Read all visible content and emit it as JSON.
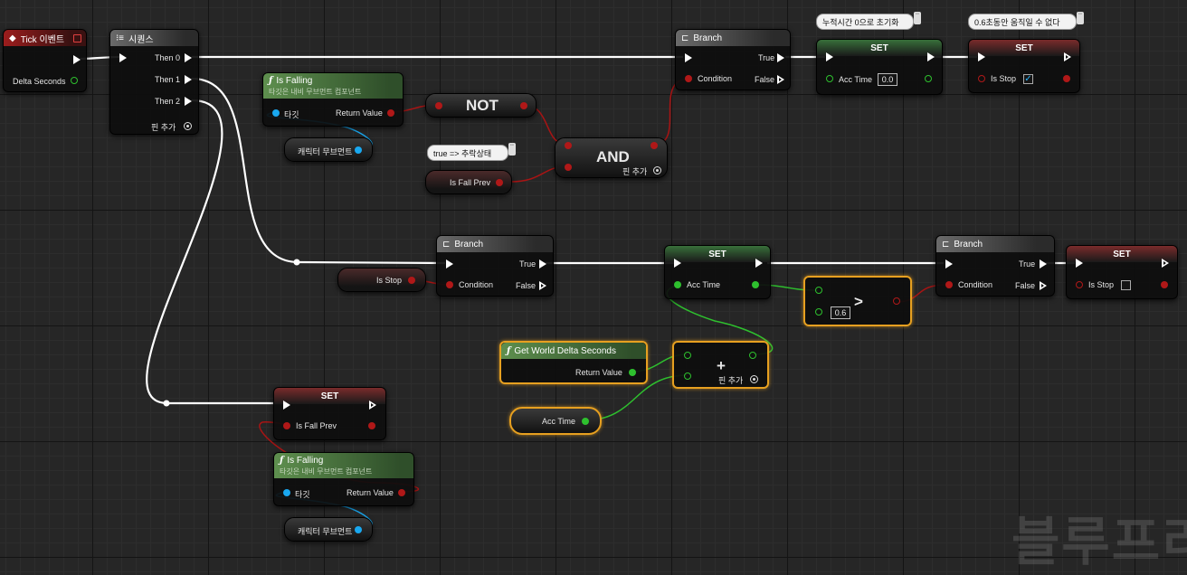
{
  "nodes": {
    "tick": {
      "title": "Tick 이벤트",
      "pin": "Delta Seconds"
    },
    "sequence": {
      "title": "시퀀스",
      "pins": [
        "Then 0",
        "Then 1",
        "Then 2"
      ],
      "add_pin": "핀 추가"
    },
    "is_falling_top": {
      "title": "Is Falling",
      "subtitle": "타깃은 내비 무브먼트 컴포넌트",
      "target": "타깃",
      "return": "Return Value"
    },
    "movement_top": {
      "label": "캐릭터 무브먼트"
    },
    "not": {
      "label": "NOT"
    },
    "and": {
      "label": "AND",
      "add_pin": "핀 추가"
    },
    "is_fall_prev_get": {
      "label": "Is Fall Prev"
    },
    "branch_top": {
      "title": "Branch",
      "condition": "Condition",
      "true": "True",
      "false": "False"
    },
    "set_acc_reset": {
      "title": "SET",
      "var": "Acc Time",
      "value": "0.0"
    },
    "set_is_stop_top": {
      "title": "SET",
      "var": "Is Stop",
      "checked": true
    },
    "is_stop_get": {
      "label": "Is Stop"
    },
    "branch_mid": {
      "title": "Branch",
      "condition": "Condition",
      "true": "True",
      "false": "False"
    },
    "set_acc_mid": {
      "title": "SET",
      "var": "Acc Time"
    },
    "greater": {
      "op": ">",
      "value": "0.6"
    },
    "branch_right": {
      "title": "Branch",
      "condition": "Condition",
      "true": "True",
      "false": "False"
    },
    "set_is_stop_right": {
      "title": "SET",
      "var": "Is Stop",
      "checked": false
    },
    "world_delta": {
      "title": "Get World Delta Seconds",
      "return": "Return Value"
    },
    "add": {
      "op": "+",
      "add_pin": "핀 추가"
    },
    "acc_time_get": {
      "label": "Acc Time"
    },
    "set_fall_prev": {
      "title": "SET",
      "var": "Is Fall Prev"
    },
    "is_falling_bottom": {
      "title": "Is Falling",
      "subtitle": "타깃은 내비 무브먼트 컴포넌트",
      "target": "타깃",
      "return": "Return Value"
    },
    "movement_bottom": {
      "label": "캐릭터 무브먼트"
    }
  },
  "comments": {
    "fall_state": "true => 추락상태",
    "reset": "누적시간 0으로 초기화",
    "stop": "0.6초동안 움직일 수 없다"
  },
  "watermark": "블루프리",
  "colors": {
    "exec": "#ffffff",
    "bool": "#b01818",
    "float": "#2ec02e",
    "object": "#19a8f0",
    "selected": "#e7a020"
  }
}
